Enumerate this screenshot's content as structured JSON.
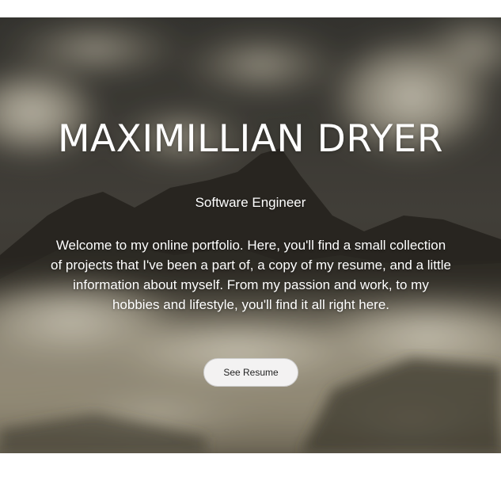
{
  "hero": {
    "title": "MAXIMILLIAN DRYER",
    "subtitle": "Software Engineer",
    "intro": "Welcome to my online portfolio. Here, you'll find a small collection of projects that I've been a part of, a copy of my resume, and a little information about myself. From my passion and work, to my hobbies and lifestyle, you'll find it all right here.",
    "button_label": "See Resume",
    "background_image": "mountain-peaks-in-clouds-photo"
  },
  "colors": {
    "text": "#ffffff",
    "button_background": "#f3f2f2",
    "button_text": "#222222",
    "page_background": "#ffffff"
  }
}
